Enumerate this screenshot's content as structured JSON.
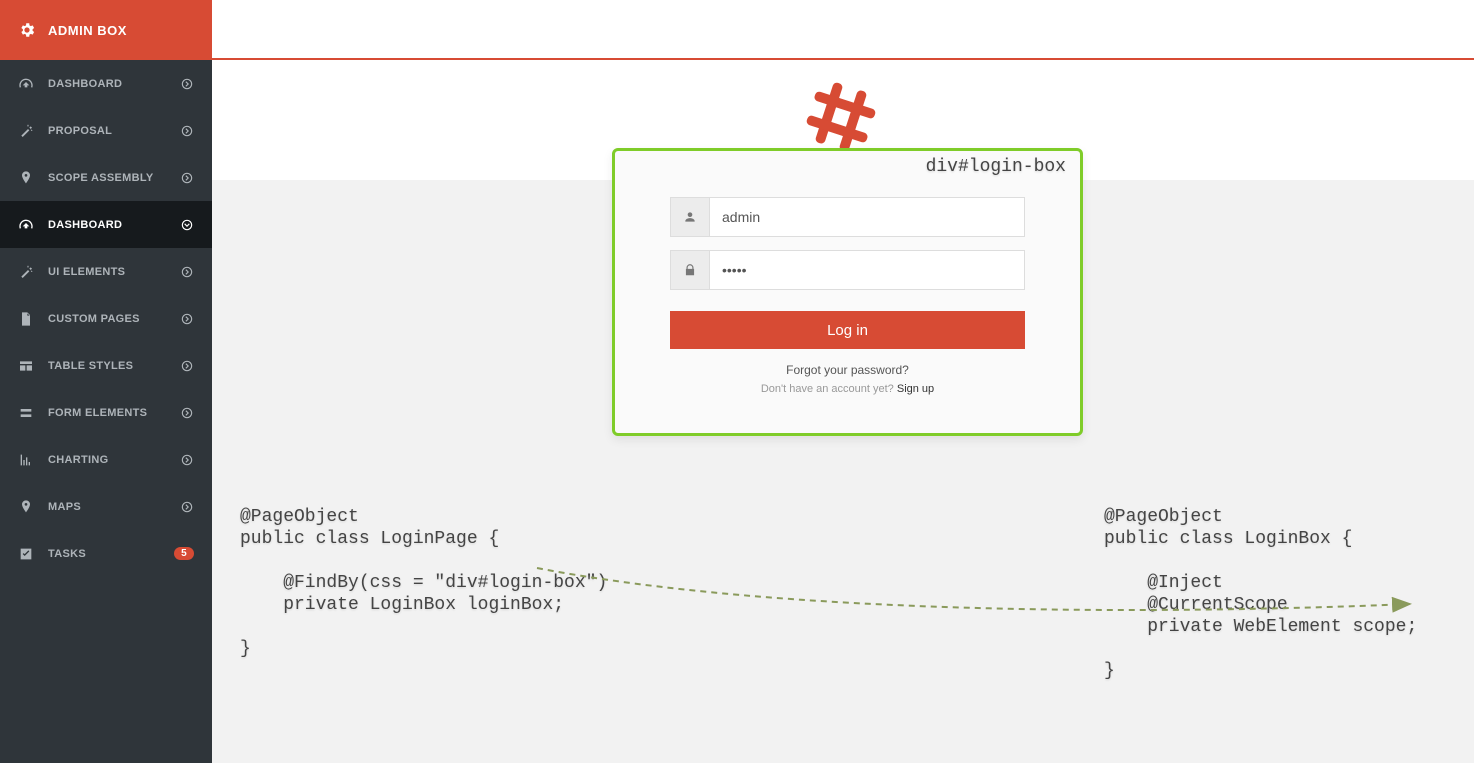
{
  "brand": {
    "title": "ADMIN BOX"
  },
  "nav": {
    "items": [
      {
        "label": "DASHBOARD"
      },
      {
        "label": "PROPOSAL"
      },
      {
        "label": "SCOPE ASSEMBLY"
      },
      {
        "label": "DASHBOARD"
      },
      {
        "label": "UI ELEMENTS"
      },
      {
        "label": "CUSTOM PAGES"
      },
      {
        "label": "TABLE STYLES"
      },
      {
        "label": "FORM ELEMENTS"
      },
      {
        "label": "CHARTING"
      },
      {
        "label": "MAPS"
      },
      {
        "label": "TASKS"
      }
    ],
    "tasks_badge": "5"
  },
  "login": {
    "frame_label": "div#login-box",
    "username_value": "admin",
    "password_value": "•••••",
    "button": "Log in",
    "forgot": "Forgot your password?",
    "noacct": "Don't have an account yet? ",
    "signup": "Sign up"
  },
  "code": {
    "left": "@PageObject\npublic class LoginPage {\n\n    @FindBy(css = \"div#login-box\")\n    private LoginBox loginBox;\n\n}",
    "right": "@PageObject\npublic class LoginBox {\n\n    @Inject\n    @CurrentScope\n    private WebElement scope;\n\n}"
  }
}
